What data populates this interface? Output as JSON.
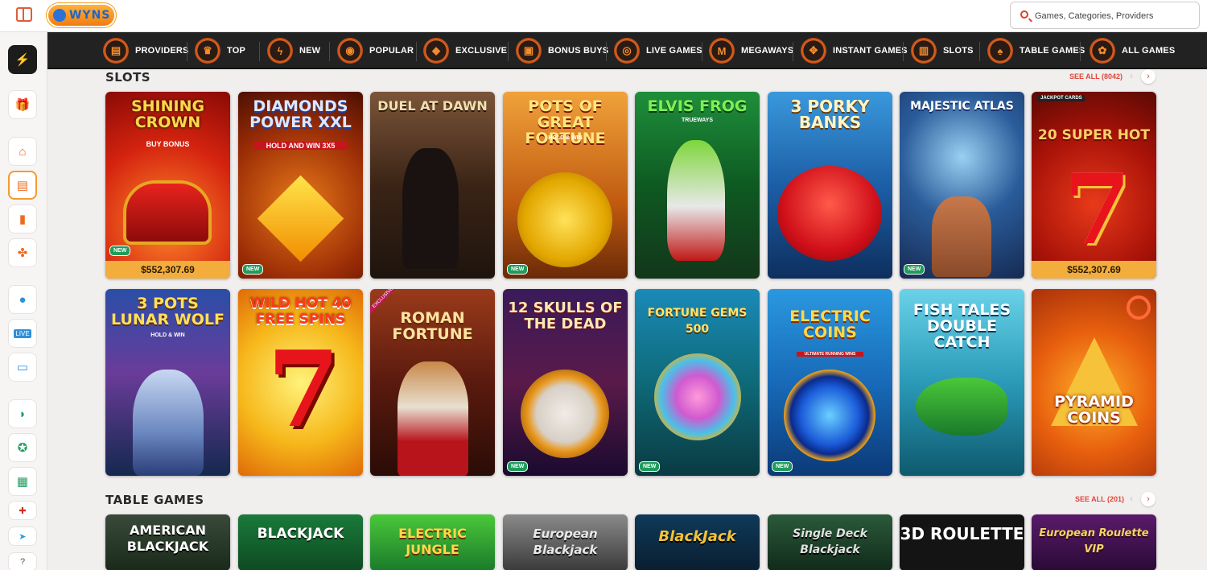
{
  "header": {
    "logo_text": "WYNS",
    "search_placeholder": "Games, Categories, Providers"
  },
  "categories": [
    "PROVIDERS",
    "TOP",
    "NEW",
    "POPULAR",
    "EXCLUSIVE",
    "BONUS BUYS",
    "LIVE GAMES",
    "MEGAWAYS",
    "INSTANT GAMES",
    "SLOTS",
    "TABLE GAMES",
    "ALL GAMES"
  ],
  "sidebar_icons": [
    "sport-icon",
    "gift-icon",
    "home-icon",
    "casino-icon",
    "cards-icon",
    "clover-icon",
    "basketball-icon",
    "live-icon",
    "monitor-icon",
    "leaf-icon",
    "award-icon",
    "toolbox-icon",
    "canada-flag-icon",
    "telegram-icon",
    "help-icon"
  ],
  "slots": {
    "title": "SLOTS",
    "see_all": "SEE ALL (8042)",
    "games": [
      {
        "title": "SHINING CROWN",
        "subtitle": "BUY BONUS",
        "badge": "NEW",
        "jackpot": "$552,307.69"
      },
      {
        "title": "DIAMONDS POWER XXL",
        "subtitle": "HOLD AND WIN 3X5",
        "badge": "NEW",
        "jackpot": ""
      },
      {
        "title": "DUEL AT DAWN",
        "subtitle": "",
        "badge": "",
        "jackpot": ""
      },
      {
        "title": "POTS OF GREAT FORTUNE",
        "subtitle": "HOLD & WIN",
        "badge": "NEW",
        "jackpot": ""
      },
      {
        "title": "ELVIS FROG",
        "subtitle": "TRUEWAYS",
        "badge": "",
        "jackpot": ""
      },
      {
        "title": "3 PORKY BANKS",
        "subtitle": "",
        "badge": "",
        "jackpot": ""
      },
      {
        "title": "MAJESTIC ATLAS",
        "subtitle": "",
        "badge": "NEW",
        "jackpot": ""
      },
      {
        "title": "20 SUPER HOT",
        "subtitle": "JACKPOT CARDS",
        "badge": "",
        "jackpot": "$552,307.69"
      },
      {
        "title": "3 POTS LUNAR WOLF",
        "subtitle": "HOLD & WIN",
        "badge": "",
        "jackpot": ""
      },
      {
        "title": "WILD HOT 40 FREE SPINS",
        "subtitle": "",
        "badge": "",
        "jackpot": ""
      },
      {
        "title": "ROMAN FORTUNE",
        "subtitle": "EXCLUSIVE",
        "badge": "",
        "jackpot": ""
      },
      {
        "title": "12 SKULLS OF THE DEAD",
        "subtitle": "",
        "badge": "NEW",
        "jackpot": ""
      },
      {
        "title": "FORTUNE GEMS 500",
        "subtitle": "",
        "badge": "NEW",
        "jackpot": ""
      },
      {
        "title": "ELECTRIC COINS",
        "subtitle": "ULTIMATE RUNNING WINS",
        "badge": "NEW",
        "jackpot": ""
      },
      {
        "title": "FISH TALES DOUBLE CATCH",
        "subtitle": "",
        "badge": "",
        "jackpot": ""
      },
      {
        "title": "PYRAMID COINS",
        "subtitle": "",
        "badge": "",
        "jackpot": ""
      }
    ]
  },
  "table_games": {
    "title": "TABLE GAMES",
    "see_all": "SEE ALL (201)",
    "games": [
      {
        "title": "AMERICAN BLACKJACK"
      },
      {
        "title": "BLACKJACK"
      },
      {
        "title": "ELECTRIC JUNGLE"
      },
      {
        "title": "European Blackjack"
      },
      {
        "title": "BlackJack"
      },
      {
        "title": "Single Deck Blackjack"
      },
      {
        "title": "3D ROULETTE"
      },
      {
        "title": "European Roulette VIP"
      }
    ]
  },
  "colors": {
    "accent": "#e0473a",
    "nav_bg": "#222222",
    "jackpot_bar": "#f3ad3d",
    "new_badge": "#1e9c5b"
  }
}
